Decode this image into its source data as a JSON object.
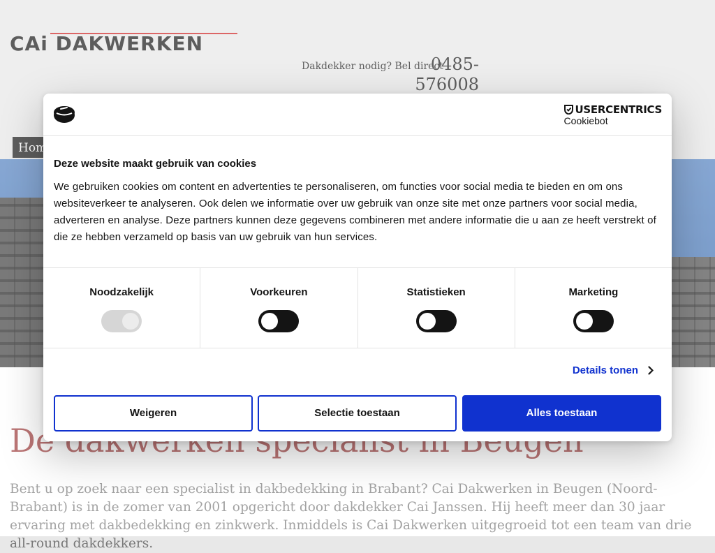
{
  "site": {
    "logo_text": "CAi DAKWERKEN",
    "callout_text": "Dakdekker nodig? Bel direct",
    "phone_line1": "0485-",
    "phone_line2": "576008",
    "nav_home": "Hom",
    "heading": "De dakwerken specialist in Beugen",
    "intro": "Bent u op zoek naar een specialist in dakbedekking in Brabant? Cai Dakwerken in Beugen (Noord-Brabant) is in de zomer van 2001 opgericht door dakdekker Cai Janssen. Hij heeft meer dan 30 jaar ervaring met dakbedekking en zinkwerk. Inmiddels is Cai Dakwerken uitgegroeid tot een team van drie all-round dakdekkers."
  },
  "cookie_dialog": {
    "brand_name": "USERCENTRICS",
    "brand_sub": "Cookiebot",
    "title": "Deze website maakt gebruik van cookies",
    "body": "We gebruiken cookies om content en advertenties te personaliseren, om functies voor social media te bieden en om ons websiteverkeer te analyseren. Ook delen we informatie over uw gebruik van onze site met onze partners voor social media, adverteren en analyse. Deze partners kunnen deze gegevens combineren met andere informatie die u aan ze heeft verstrekt of die ze hebben verzameld op basis van uw gebruik van hun services.",
    "toggles": [
      {
        "label": "Noodzakelijk",
        "state": "on",
        "disabled": true
      },
      {
        "label": "Voorkeuren",
        "state": "off",
        "disabled": false
      },
      {
        "label": "Statistieken",
        "state": "off",
        "disabled": false
      },
      {
        "label": "Marketing",
        "state": "off",
        "disabled": false
      }
    ],
    "details_label": "Details tonen",
    "buttons": {
      "decline": "Weigeren",
      "allow_selection": "Selectie toestaan",
      "allow_all": "Alles toestaan"
    }
  },
  "colors": {
    "accent": "#1032cf",
    "heading": "#9b3434",
    "logo_line": "#cc1e1e"
  },
  "icons": {
    "cookie": "cookie-icon",
    "shield": "shield-icon",
    "details_chevron": "chevron-right-icon"
  }
}
